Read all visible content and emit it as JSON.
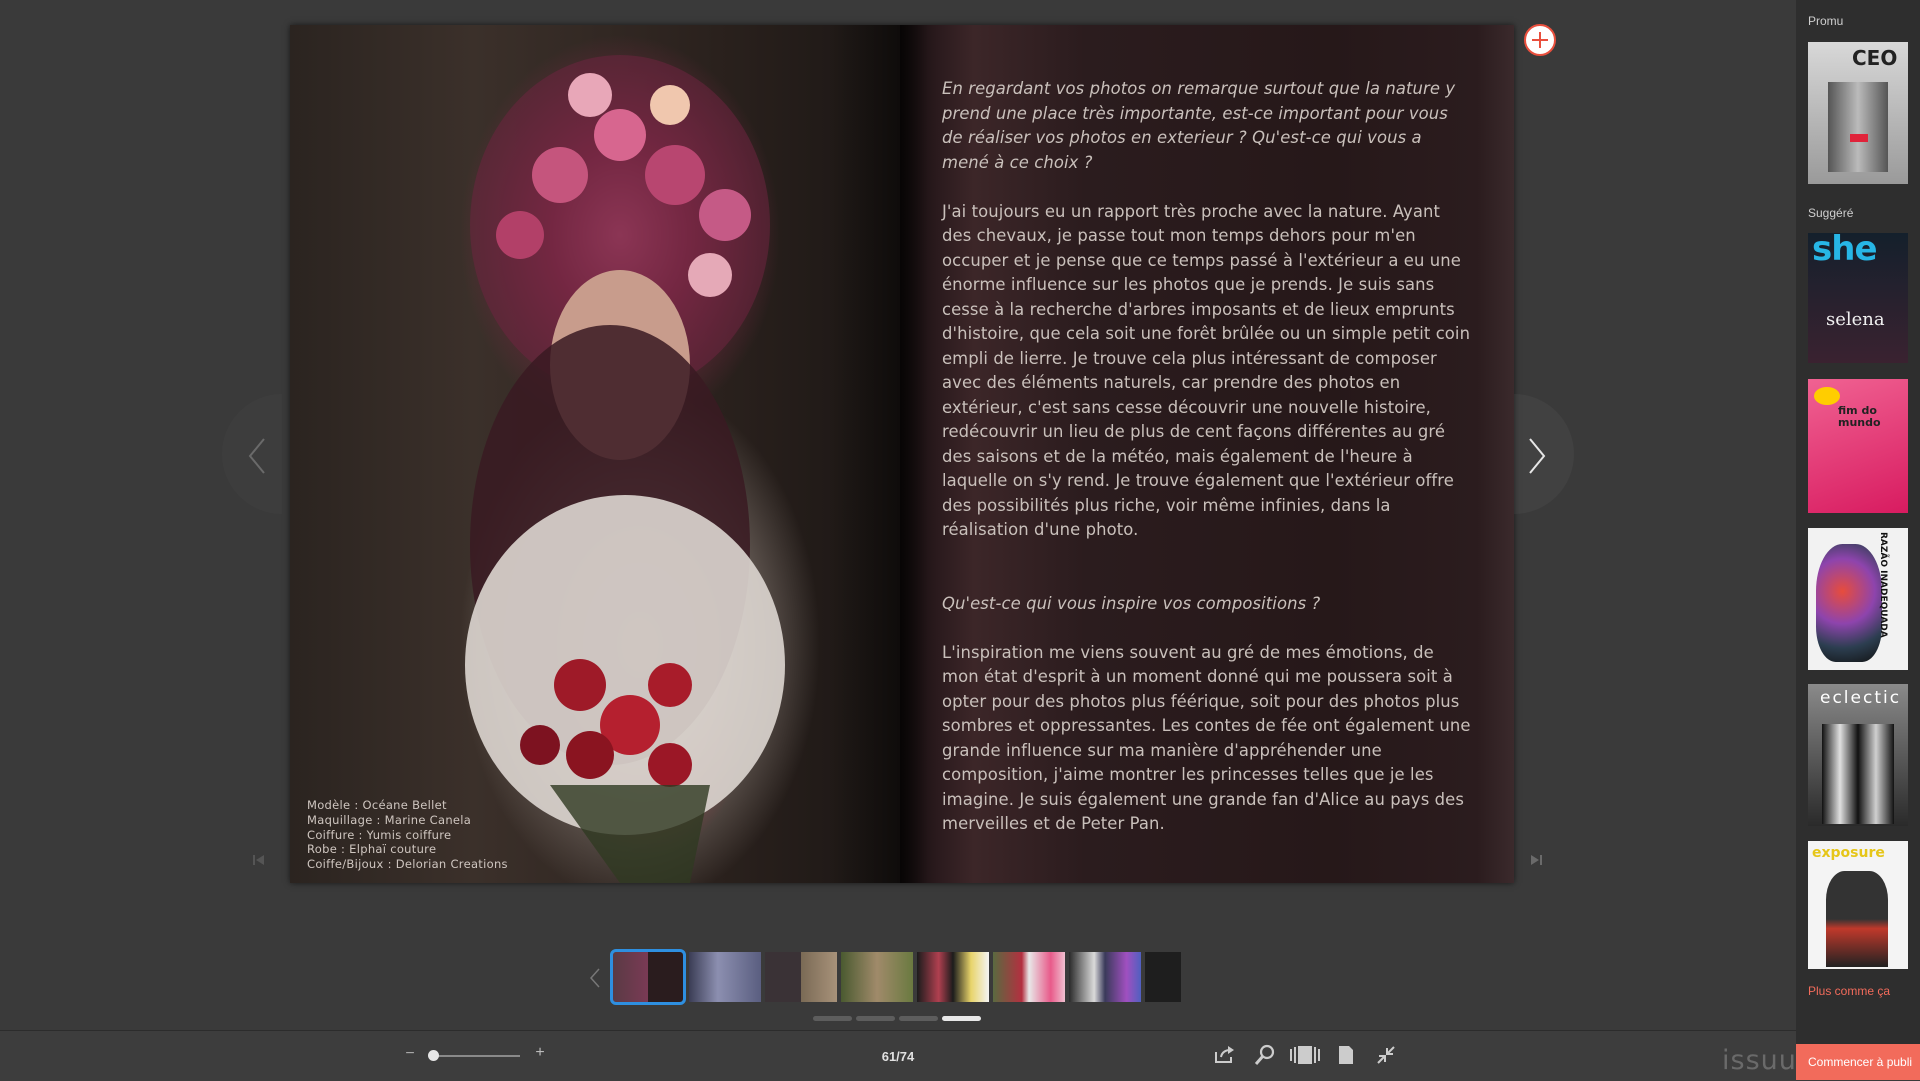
{
  "reader": {
    "credits": [
      "Modèle : Océane Bellet",
      "Maquillage : Marine Canela",
      "Coiffure : Yumis coiffure",
      "Robe : Elphaï couture",
      "Coiffe/Bijoux : Delorian Creations"
    ],
    "article": {
      "q1": "En regardant vos photos on remarque surtout que la nature y prend une place très importante, est-ce important pour vous de réaliser vos photos en exterieur ? Qu'est-ce qui vous a mené à ce choix ?",
      "a1": "J'ai toujours eu un rapport très proche avec la nature. Ayant des chevaux, je passe tout mon temps dehors pour m'en occuper et je pense que ce temps passé à l'extérieur a eu une énorme influence sur les photos que je prends. Je suis sans cesse à la recherche d'arbres imposants et de lieux emprunts d'histoire, que cela soit une forêt brûlée ou un simple petit coin empli de lierre. Je trouve cela plus intéressant de composer avec des éléments naturels, car prendre des photos en extérieur, c'est sans cesse découvrir une nouvelle histoire, redécouvrir un lieu de plus de cent façons différentes au gré des saisons et de la météo, mais également de l'heure à laquelle on s'y rend. Je trouve également que l'extérieur offre des possibilités plus riche, voir même infinies, dans la réalisation d'une photo.",
      "q2": "Qu'est-ce qui vous inspire vos compositions ?",
      "a2": "L'inspiration me viens souvent au gré de mes émotions, de mon état d'esprit à un moment donné qui me poussera soit à opter pour des photos plus féérique, soit pour des photos plus sombres et oppressantes. Les contes de fée ont également une grande influence sur ma manière d'appréhender une composition, j'aime montrer les princesses telles que je les imagine. Je suis également une grande fan d'Alice au pays des merveilles et de Peter Pan."
    },
    "thumbnails_count": 9,
    "page_dots": 4,
    "active_dot": 3
  },
  "toolbar": {
    "zoom_minus": "−",
    "zoom_plus": "+",
    "zoom_level": 0.0,
    "page_counter": "61/74",
    "icons": [
      "share-icon",
      "search-icon",
      "spread-view-icon",
      "single-page-icon",
      "exit-fullscreen-icon"
    ],
    "brand": "issuu"
  },
  "sidebar": {
    "promo_label": "Promu",
    "suggested_label": "Suggéré",
    "covers": [
      {
        "title": "CEO",
        "bg": "#c9c9c9",
        "accent": "#e0233a"
      },
      {
        "title": "she",
        "subtitle": "selena",
        "bg": "#1a2a3a",
        "accent": "#27b6e6"
      },
      {
        "title": "fim do mundo",
        "bg": "#e6407a",
        "accent": "#ffcd00"
      },
      {
        "title": "RAZÃO INADEQUADA",
        "bg": "#f2f2f2",
        "accent": "#d63a2f"
      },
      {
        "title": "eclectic",
        "bg": "#6b6b6b",
        "accent": "#ffffff"
      },
      {
        "title": "exposure",
        "bg": "#f4f4f4",
        "accent": "#e6c619"
      }
    ],
    "more_link": "Plus comme ça",
    "publish_button": "Commencer à publi"
  },
  "colors": {
    "background": "#3a3a3a",
    "accent": "#f26b5b",
    "active_thumb": "#2e8fe0"
  }
}
